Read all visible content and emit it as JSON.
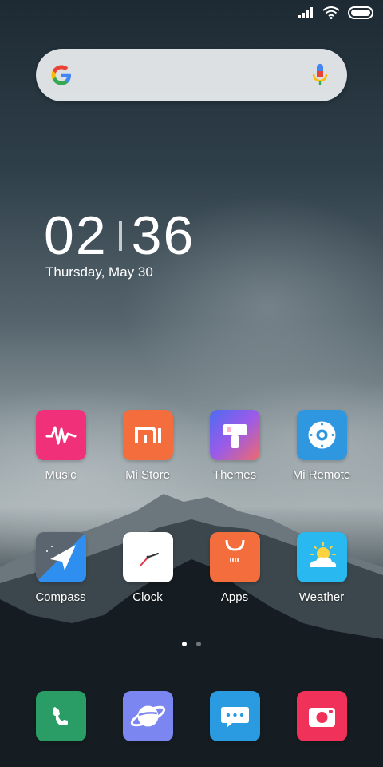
{
  "status_bar": {
    "signal_icon": "signal-icon",
    "wifi_icon": "wifi-icon",
    "battery_icon": "battery-icon"
  },
  "search": {
    "logo_icon": "google-logo-icon",
    "mic_icon": "mic-icon"
  },
  "clock": {
    "hours": "02",
    "minutes": "36",
    "date": "Thursday, May 30"
  },
  "apps_row1": [
    {
      "label": "Music",
      "icon": "music-icon",
      "color": "#f0317a"
    },
    {
      "label": "Mi Store",
      "icon": "mi-store-icon",
      "color": "#f46d3c"
    },
    {
      "label": "Themes",
      "icon": "themes-icon",
      "color": "#7a5cf0"
    },
    {
      "label": "Mi Remote",
      "icon": "mi-remote-icon",
      "color": "#2f96e0"
    }
  ],
  "apps_row2": [
    {
      "label": "Compass",
      "icon": "compass-icon",
      "color": "#5a6570"
    },
    {
      "label": "Clock",
      "icon": "clock-icon",
      "color": "#ffffff"
    },
    {
      "label": "Apps",
      "icon": "apps-store-icon",
      "color": "#f46d3c"
    },
    {
      "label": "Weather",
      "icon": "weather-icon",
      "color": "#2ab8f0"
    }
  ],
  "pager": {
    "pages": 2,
    "active": 1
  },
  "dock": [
    {
      "icon": "phone-icon",
      "color": "#2a9d66"
    },
    {
      "icon": "browser-icon",
      "color": "#7b86f0"
    },
    {
      "icon": "messages-icon",
      "color": "#2a9be0"
    },
    {
      "icon": "camera-icon",
      "color": "#f0325a"
    }
  ]
}
